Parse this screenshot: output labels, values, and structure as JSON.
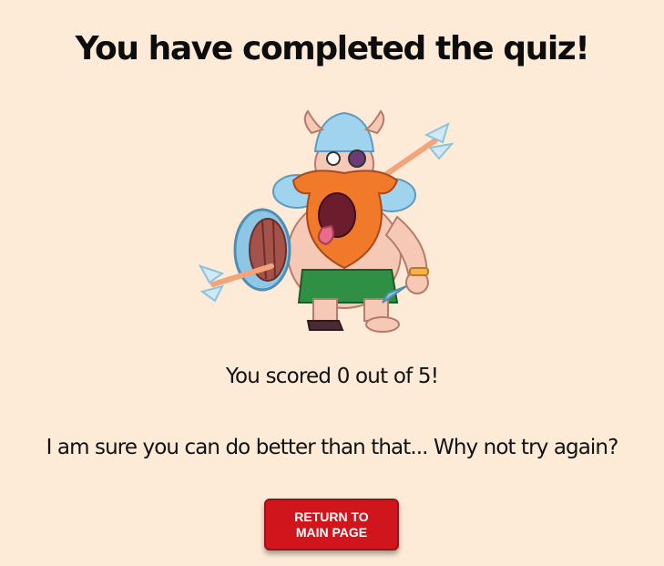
{
  "quiz_result": {
    "title": "You have completed the quiz!",
    "score_text": "You scored 0 out of 5!",
    "message": "I am sure you can do better than that... Why not try again?",
    "illustration": "defeated-viking-character"
  },
  "actions": {
    "return_line1": "RETURN TO",
    "return_line2": "MAIN PAGE"
  },
  "colors": {
    "background": "#fdebd8",
    "button": "#d0161c",
    "text": "#111111"
  }
}
